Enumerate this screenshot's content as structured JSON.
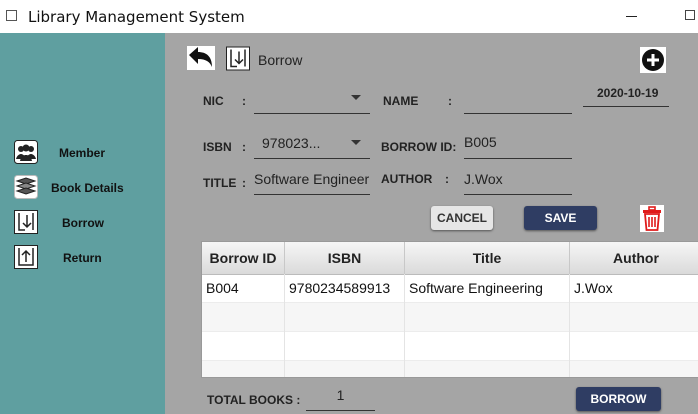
{
  "window": {
    "title": "Library Management System"
  },
  "sidebar": {
    "items": [
      {
        "label": "Member",
        "icon": "members-icon"
      },
      {
        "label": "Book Details",
        "icon": "books-icon"
      },
      {
        "label": "Borrow",
        "icon": "borrow-icon"
      },
      {
        "label": "Return",
        "icon": "return-icon"
      }
    ]
  },
  "header": {
    "title": "Borrow",
    "date": "2020-10-19"
  },
  "form": {
    "nic_label": "NIC",
    "nic_value": "",
    "name_label": "NAME",
    "name_value": "",
    "colon": ":",
    "isbn_label": "ISBN",
    "isbn_value": "978023...",
    "borrow_id_label": "BORROW ID:",
    "borrow_id_value": "B005",
    "title_label": "TITLE",
    "title_value": "Software Engineer",
    "author_label": "AUTHOR",
    "author_value": "J.Wox"
  },
  "buttons": {
    "cancel": "CANCEL",
    "save": "SAVE",
    "borrow": "BORROW"
  },
  "table": {
    "headers": [
      "Borrow ID",
      "ISBN",
      "Title",
      "Author"
    ],
    "rows": [
      [
        "B004",
        "9780234589913",
        "Software Engineering",
        "J.Wox"
      ]
    ]
  },
  "footer": {
    "total_label": "TOTAL BOOKS :",
    "total_value": "1"
  },
  "colors": {
    "sidebar": "#5f9fa0",
    "main_bg": "#a5a5a5",
    "primary_button": "#2f3d63",
    "delete": "#e01b1b"
  }
}
